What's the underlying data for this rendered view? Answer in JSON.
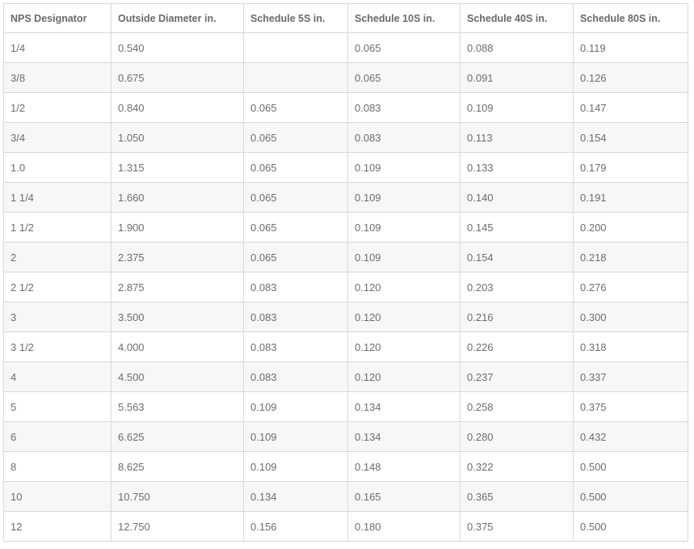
{
  "table": {
    "headers": [
      "NPS Designator",
      "Outside Diameter in.",
      "Schedule 5S in.",
      "Schedule 10S in.",
      "Schedule 40S in.",
      "Schedule 80S in."
    ],
    "rows": [
      [
        "1/4",
        "0.540",
        "",
        "0.065",
        "0.088",
        "0.119"
      ],
      [
        "3/8",
        "0.675",
        "",
        "0.065",
        "0.091",
        "0.126"
      ],
      [
        "1/2",
        "0.840",
        "0.065",
        "0.083",
        "0.109",
        "0.147"
      ],
      [
        "3/4",
        "1.050",
        "0.065",
        "0.083",
        "0.113",
        "0.154"
      ],
      [
        "1.0",
        "1.315",
        "0.065",
        "0.109",
        "0.133",
        "0.179"
      ],
      [
        "1 1/4",
        "1.660",
        "0.065",
        "0.109",
        "0.140",
        "0.191"
      ],
      [
        "1 1/2",
        "1.900",
        "0.065",
        "0.109",
        "0.145",
        "0.200"
      ],
      [
        "2",
        "2.375",
        "0.065",
        "0.109",
        "0.154",
        "0.218"
      ],
      [
        "2 1/2",
        "2.875",
        "0.083",
        "0.120",
        "0.203",
        "0.276"
      ],
      [
        "3",
        "3.500",
        "0.083",
        "0.120",
        "0.216",
        "0.300"
      ],
      [
        "3 1/2",
        "4.000",
        "0.083",
        "0.120",
        "0.226",
        "0.318"
      ],
      [
        "4",
        "4.500",
        "0.083",
        "0.120",
        "0.237",
        "0.337"
      ],
      [
        "5",
        "5.563",
        "0.109",
        "0.134",
        "0.258",
        "0.375"
      ],
      [
        "6",
        "6.625",
        "0.109",
        "0.134",
        "0.280",
        "0.432"
      ],
      [
        "8",
        "8.625",
        "0.109",
        "0.148",
        "0.322",
        "0.500"
      ],
      [
        "10",
        "10.750",
        "0.134",
        "0.165",
        "0.365",
        "0.500"
      ],
      [
        "12",
        "12.750",
        "0.156",
        "0.180",
        "0.375",
        "0.500"
      ]
    ]
  },
  "colors": {
    "border": "#d9d9d9",
    "text": "#6d6d6d",
    "stripe": "#f7f7f7"
  }
}
